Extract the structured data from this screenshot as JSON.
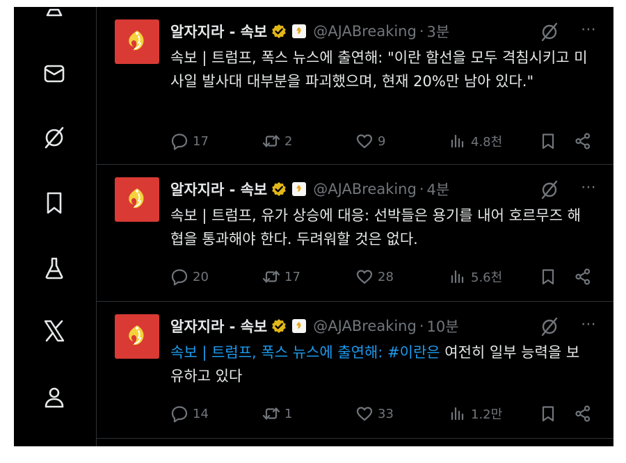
{
  "sidebar": {
    "items": [
      {
        "icon": "person-outline-icon"
      },
      {
        "icon": "mail-icon"
      },
      {
        "icon": "grok-icon"
      },
      {
        "icon": "bookmark-icon"
      },
      {
        "icon": "labs-flask-icon"
      },
      {
        "icon": "x-logo-icon"
      },
      {
        "icon": "profile-icon"
      }
    ]
  },
  "colors": {
    "background": "#000000",
    "text": "#e7e9ea",
    "muted": "#71767b",
    "link": "#1d9bf0",
    "avatar": "#d93a34",
    "verified_gold": "#e2b719"
  },
  "tweets": [
    {
      "name": "알자지라 - 속보",
      "handle": "@AJABreaking",
      "sep": "·",
      "time": "3분",
      "text": "속보 | 트럼프, 폭스 뉴스에 출연해: \"이란 함선을 모두 격침시키고 미사일 발사대 대부분을 파괴했으며, 현재 20%만 남아 있다.\"",
      "replies": "17",
      "reposts": "2",
      "likes": "9",
      "views": "4.8천"
    },
    {
      "name": "알자지라 - 속보",
      "handle": "@AJABreaking",
      "sep": "·",
      "time": "4분",
      "text": "속보 | 트럼프, 유가 상승에 대응: 선박들은 용기를 내어 호르무즈 해협을 통과해야 한다. 두려워할 것은 없다.",
      "replies": "20",
      "reposts": "17",
      "likes": "28",
      "views": "5.6천"
    },
    {
      "name": "알자지라 - 속보",
      "handle": "@AJABreaking",
      "sep": "·",
      "time": "10분",
      "text_link": "속보 | 트럼프, 폭스 뉴스에 출연해: #이란은",
      "text": " 여전히 일부 능력을 보유하고 있다",
      "replies": "14",
      "reposts": "1",
      "likes": "33",
      "views": "1.2만"
    }
  ]
}
